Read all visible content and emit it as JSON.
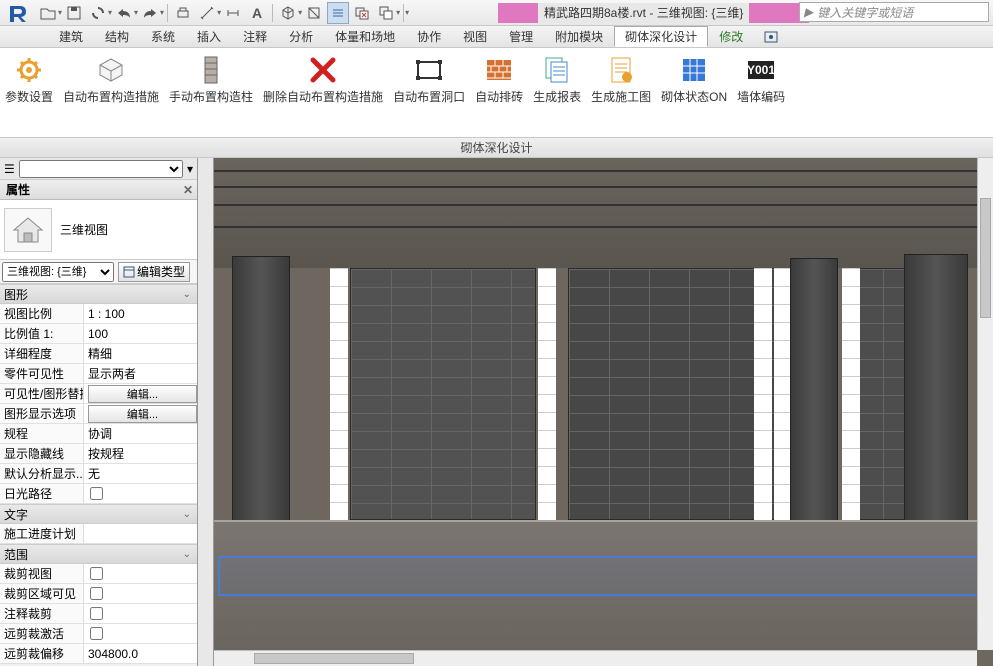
{
  "title": {
    "file": "精武路四期8a楼.rvt",
    "sep": " - ",
    "view": "三维视图: {三维}"
  },
  "search": {
    "placeholder": "键入关键字或短语"
  },
  "menus": [
    "建筑",
    "结构",
    "系统",
    "插入",
    "注释",
    "分析",
    "体量和场地",
    "协作",
    "视图",
    "管理",
    "附加模块",
    "砌体深化设计",
    "修改"
  ],
  "active_menu": 11,
  "ribbon": [
    {
      "name": "param-settings",
      "label": "参数设置",
      "icon": "gear"
    },
    {
      "name": "auto-layout-measure",
      "label": "自动布置构造措施",
      "icon": "box"
    },
    {
      "name": "manual-layout-column",
      "label": "手动布置构造柱",
      "icon": "column"
    },
    {
      "name": "delete-auto-layout",
      "label": "删除自动布置构造措施",
      "icon": "x"
    },
    {
      "name": "auto-layout-opening",
      "label": "自动布置洞口",
      "icon": "rect"
    },
    {
      "name": "auto-brick",
      "label": "自动排砖",
      "icon": "bricks"
    },
    {
      "name": "gen-report",
      "label": "生成报表",
      "icon": "sheets"
    },
    {
      "name": "gen-construction",
      "label": "生成施工图",
      "icon": "doc"
    },
    {
      "name": "brick-status-on",
      "label": "砌体状态ON",
      "icon": "grid"
    },
    {
      "name": "wall-code",
      "label": "墙体编码",
      "icon": "y001"
    }
  ],
  "panel": {
    "title": "砌体深化设计"
  },
  "props": {
    "header": "属性",
    "type_label": "三维视图",
    "instance_selector": "三维视图: {三维}",
    "edit_type": "编辑类型",
    "groups": [
      {
        "name": "图形",
        "rows": [
          {
            "l": "视图比例",
            "v": "1 : 100"
          },
          {
            "l": "比例值 1:",
            "v": "100"
          },
          {
            "l": "详细程度",
            "v": "精细"
          },
          {
            "l": "零件可见性",
            "v": "显示两者"
          },
          {
            "l": "可见性/图形替换",
            "v": "编辑...",
            "btn": true
          },
          {
            "l": "图形显示选项",
            "v": "编辑...",
            "btn": true
          },
          {
            "l": "规程",
            "v": "协调"
          },
          {
            "l": "显示隐藏线",
            "v": "按规程"
          },
          {
            "l": "默认分析显示...",
            "v": "无"
          },
          {
            "l": "日光路径",
            "v": "",
            "chk": true
          }
        ]
      },
      {
        "name": "文字",
        "rows": [
          {
            "l": "施工进度计划",
            "v": ""
          }
        ]
      },
      {
        "name": "范围",
        "rows": [
          {
            "l": "裁剪视图",
            "v": "",
            "chk": true
          },
          {
            "l": "裁剪区域可见",
            "v": "",
            "chk": true
          },
          {
            "l": "注释裁剪",
            "v": "",
            "chk": true
          },
          {
            "l": "远剪裁激活",
            "v": "",
            "chk": true
          },
          {
            "l": "远剪裁偏移",
            "v": "304800.0"
          }
        ]
      }
    ]
  }
}
